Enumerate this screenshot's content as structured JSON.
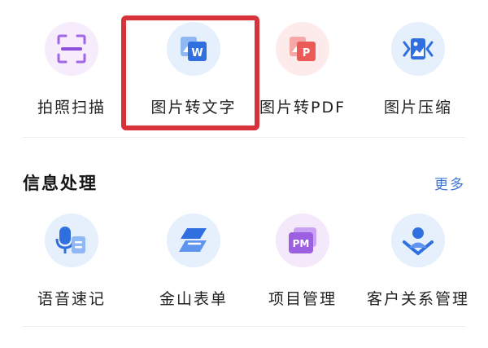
{
  "top_tools": [
    {
      "label": "拍照扫描",
      "icon": "scan-icon",
      "bg": "#f6ecfb"
    },
    {
      "label": "图片转文字",
      "icon": "image-to-text-icon",
      "bg": "#e6f0fd"
    },
    {
      "label": "图片转PDF",
      "icon": "image-to-pdf-icon",
      "bg": "#fdebec"
    },
    {
      "label": "图片压缩",
      "icon": "image-compress-icon",
      "bg": "#e6f0fd"
    }
  ],
  "section": {
    "title": "信息处理",
    "more_label": "更多"
  },
  "info_tools": [
    {
      "label": "语音速记",
      "icon": "voice-memo-icon",
      "bg": "#e6f0fd"
    },
    {
      "label": "金山表单",
      "icon": "form-icon",
      "bg": "#e6f0fd"
    },
    {
      "label": "项目管理",
      "icon": "project-management-icon",
      "bg": "#f4e8fb"
    },
    {
      "label": "客户关系管理",
      "icon": "crm-icon",
      "bg": "#e6f0fd"
    }
  ],
  "colors": {
    "accent_blue": "#3f74d8",
    "highlight_red": "#d8323b",
    "purple": "#9b5fe0",
    "red": "#ec5a57"
  }
}
